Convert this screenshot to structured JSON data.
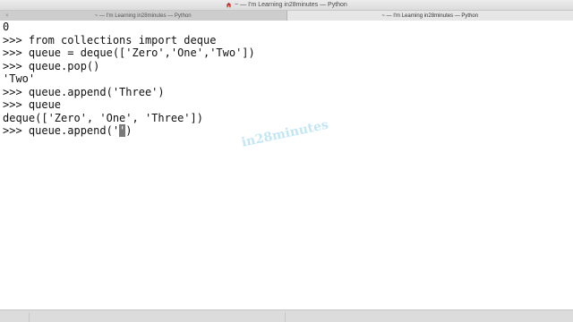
{
  "window": {
    "title": "~ — I'm Learning in28minutes — Python"
  },
  "tabs": [
    {
      "label": "~ — I'm Learning in28minutes — Python",
      "active": false
    },
    {
      "label": "~ — I'm Learning in28minutes — Python",
      "active": true
    }
  ],
  "terminal": {
    "lines": [
      "0",
      ">>> from collections import deque",
      ">>> queue = deque(['Zero','One','Two'])",
      ">>> queue.pop()",
      "'Two'",
      ">>> queue.append('Three')",
      ">>> queue",
      "deque(['Zero', 'One', 'Three'])"
    ],
    "current_input": {
      "before_cursor": ">>> queue.append('",
      "cursor_char": "'",
      "after_cursor": ")"
    }
  },
  "watermark": "in28minutes",
  "icons": {
    "home": "home-icon"
  }
}
